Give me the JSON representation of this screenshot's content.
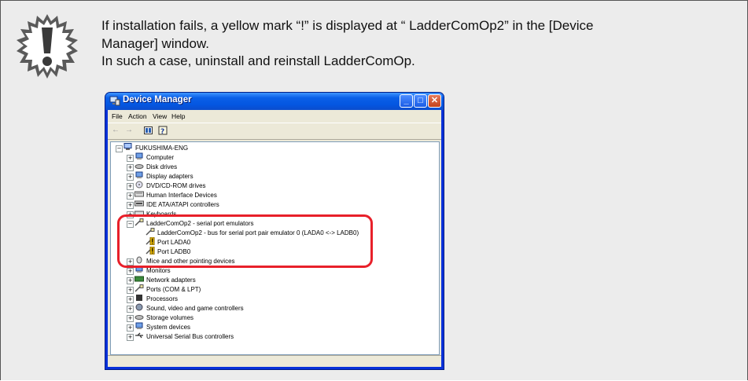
{
  "note": {
    "icon": "exclamation-starburst-icon",
    "lines": [
      "If installation fails, a yellow mark “!” is displayed at “ LadderComOp2” in the [Device",
      "Manager] window.",
      "In such a case, uninstall and reinstall LadderComOp."
    ]
  },
  "window": {
    "title": "Device Manager",
    "menu": [
      "File",
      "Action",
      "View",
      "Help"
    ],
    "root": "FUKUSHIMA-ENG",
    "items_top": [
      "Computer",
      "Disk drives",
      "Display adapters",
      "DVD/CD-ROM drives",
      "Human Interface Devices",
      "IDE ATA/ATAPI controllers",
      "Keyboards"
    ],
    "group": "LadderComOp2 - serial port emulators",
    "group_children": [
      "LadderComOp2 - bus for serial port pair emulator 0 (LADA0 <-> LADB0)",
      "Port LADA0",
      "Port LADB0"
    ],
    "hidden_item": "Mice and other pointing devices",
    "items_bottom": [
      "Monitors",
      "Network adapters",
      "Ports (COM & LPT)",
      "Processors",
      "Sound, video and game controllers",
      "Storage volumes",
      "System devices",
      "Universal Serial Bus controllers"
    ]
  },
  "colors": {
    "highlight": "#e8202a",
    "titlebar": "#0a5fe8",
    "warning": "#f2c200"
  }
}
